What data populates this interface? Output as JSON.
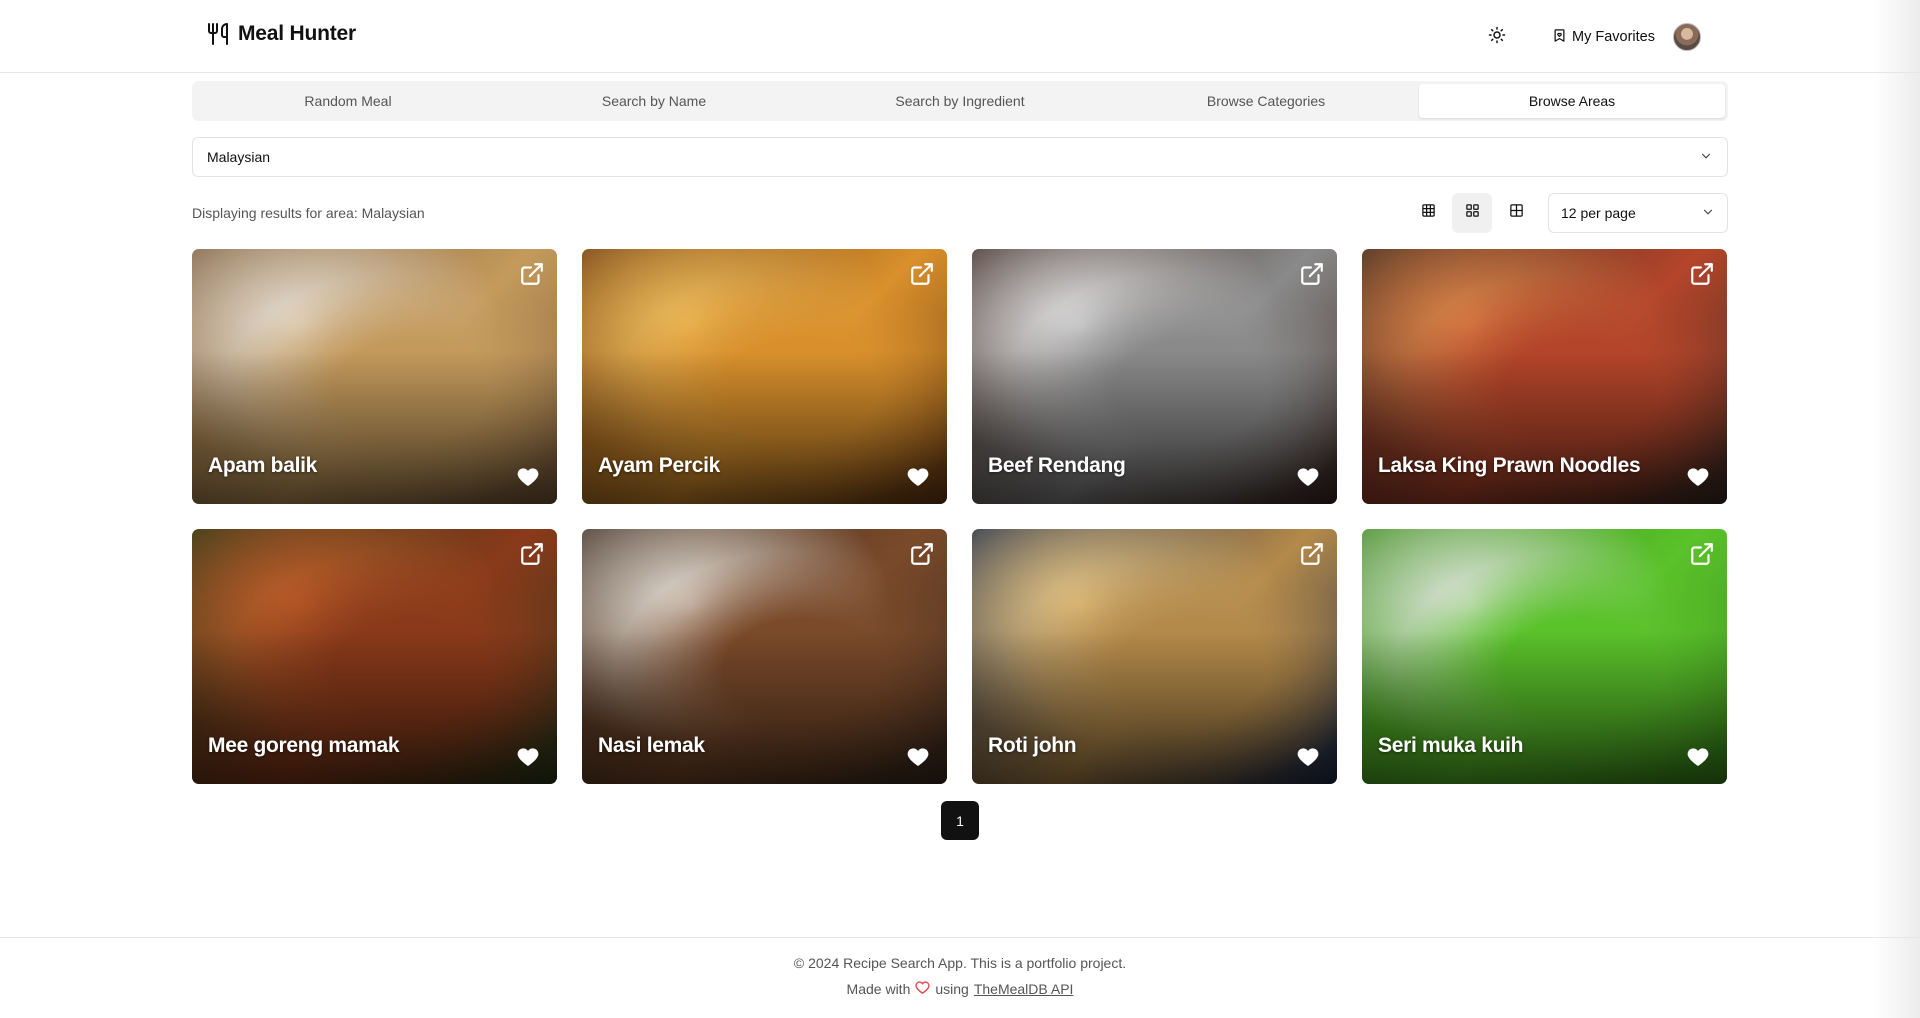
{
  "header": {
    "brand_title": "Meal Hunter",
    "brand_icon": "utensils-icon",
    "theme_icon": "sun-icon",
    "favorites_label": "My Favorites",
    "favorites_icon": "bookmark-heart-icon"
  },
  "tabs": [
    {
      "label": "Random Meal",
      "active": false
    },
    {
      "label": "Search by Name",
      "active": false
    },
    {
      "label": "Search by Ingredient",
      "active": false
    },
    {
      "label": "Browse Categories",
      "active": false
    },
    {
      "label": "Browse Areas",
      "active": true
    }
  ],
  "area_select": {
    "value": "Malaysian"
  },
  "results": {
    "text": "Displaying results for area: Malaysian",
    "view_modes": [
      "grid-small-icon",
      "grid-medium-icon",
      "grid-large-icon"
    ],
    "active_view": 1,
    "per_page": "12 per page"
  },
  "meals": [
    {
      "name": "Apam balik",
      "colors": [
        "#7a5a3a",
        "#c49a5c",
        "#e8e2d8"
      ]
    },
    {
      "name": "Ayam Percik",
      "colors": [
        "#6b3a12",
        "#d9902c",
        "#f0c060"
      ]
    },
    {
      "name": "Beef Rendang",
      "colors": [
        "#3a2620",
        "#8a8a8a",
        "#e6e6e6"
      ]
    },
    {
      "name": "Laksa King Prawn Noodles",
      "colors": [
        "#3a2a22",
        "#b4452a",
        "#e08a4a"
      ]
    },
    {
      "name": "Mee goreng mamak",
      "colors": [
        "#2a3a1a",
        "#8a3a1a",
        "#c4602a"
      ]
    },
    {
      "name": "Nasi lemak",
      "colors": [
        "#3a2a1e",
        "#7a4a2a",
        "#e8e4dc"
      ]
    },
    {
      "name": "Roti john",
      "colors": [
        "#1a2a4a",
        "#b48a4a",
        "#e8c888"
      ]
    },
    {
      "name": "Seri muka kuih",
      "colors": [
        "#3a8a1a",
        "#5ac22a",
        "#e6e6e6"
      ]
    }
  ],
  "pagination": {
    "current": "1"
  },
  "footer": {
    "line1": "© 2024 Recipe Search App. This is a portfolio project.",
    "made_with": "Made with",
    "using": "using",
    "api_link": "TheMealDB API",
    "heart_color": "#e5484d"
  }
}
